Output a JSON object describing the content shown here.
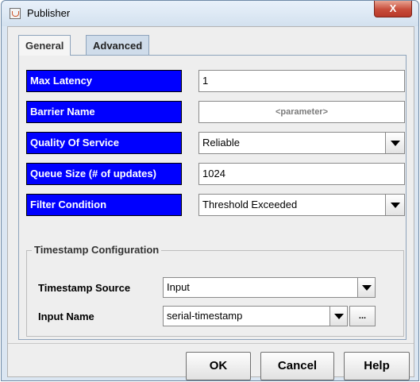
{
  "window": {
    "title": "Publisher",
    "close_label": "X"
  },
  "tabs": [
    {
      "label": "General"
    },
    {
      "label": "Advanced"
    }
  ],
  "fields": {
    "max_latency": {
      "label": "Max Latency",
      "value": "1"
    },
    "barrier_name": {
      "label": "Barrier Name",
      "value": "<parameter>"
    },
    "quality_of_service": {
      "label": "Quality Of Service",
      "value": "Reliable"
    },
    "queue_size": {
      "label": "Queue Size (# of updates)",
      "value": "1024"
    },
    "filter_condition": {
      "label": "Filter Condition",
      "value": "Threshold Exceeded"
    }
  },
  "timestamp_group": {
    "title": "Timestamp Configuration",
    "source": {
      "label": "Timestamp Source",
      "value": "Input"
    },
    "input_name": {
      "label": "Input Name",
      "value": "serial-timestamp",
      "browse_label": "..."
    }
  },
  "buttons": {
    "ok": "OK",
    "cancel": "Cancel",
    "help": "Help"
  },
  "colors": {
    "label_bg": "#0000ff",
    "label_text": "#ffffff",
    "close_button": "#c74c3a"
  },
  "icons": {
    "app": "java-cup-icon",
    "dropdown": "dropdown-arrow-icon",
    "close": "close-icon"
  }
}
